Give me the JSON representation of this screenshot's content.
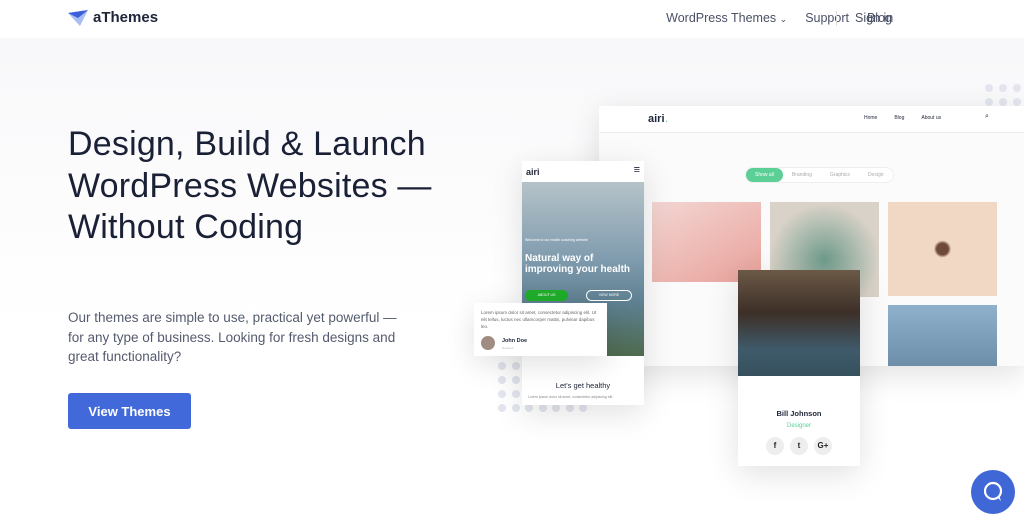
{
  "header": {
    "brand": "aThemes",
    "nav": [
      {
        "label": "WordPress Themes"
      },
      {
        "label": "Support"
      },
      {
        "label": "Blog"
      }
    ],
    "signin": "Sign in"
  },
  "hero": {
    "title": "Design, Build & Launch WordPress Websites — Without Coding",
    "lead": "Our themes are simple to use, practical yet powerful — for any type of business. Looking for fresh designs and great functionality?",
    "cta": "View Themes"
  },
  "desktop_mock": {
    "brand": "airi",
    "nav": [
      "Home",
      "Blog",
      "About us"
    ],
    "filters": [
      "Show all",
      "Branding",
      "Graphics",
      "Design"
    ]
  },
  "mobile_mock": {
    "brand": "airi",
    "welcome": "Welcome to our health coaching website",
    "headline": "Natural way of improving your health",
    "btn1": "ABOUT US",
    "btn2": "VIEW MORE",
    "section": "Let's get healthy",
    "body": "Lorem ipsum dolor sit amet, consectetur adipiscing elit."
  },
  "testimonial": {
    "text": "Lorem ipsum dolor sit amet, consectetur adipiscing elit. Ut elit tellus, luctus nec ullamcorper mattis, pulvinar dapibus leo.",
    "name": "John Doe",
    "role": "Designer"
  },
  "profile": {
    "name": "Bill Johnson",
    "role": "Designer",
    "social": [
      "f",
      "t",
      "G+"
    ]
  },
  "colors": {
    "accent": "#4169d9",
    "mock_green": "#5ccf96",
    "mock_button": "#1fae2a"
  }
}
